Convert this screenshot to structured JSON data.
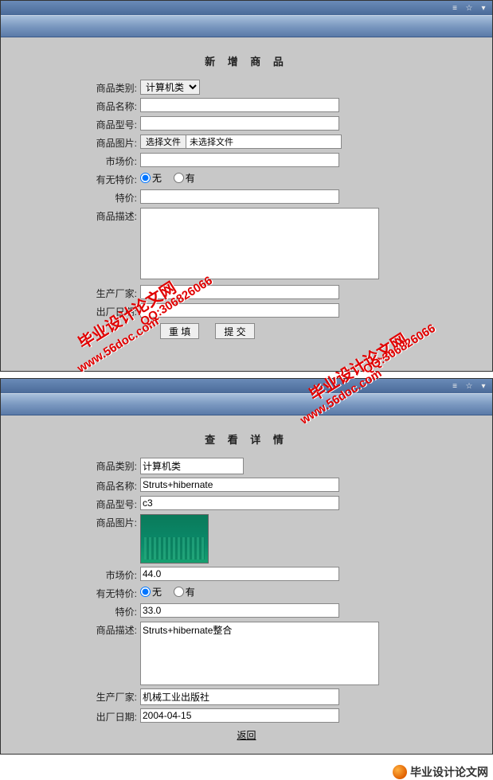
{
  "window1": {
    "title": "新 增 商 品",
    "labels": {
      "category": "商品类别:",
      "name": "商品名称:",
      "model": "商品型号:",
      "image": "商品图片:",
      "market_price": "市场价:",
      "has_special": "有无特价:",
      "special_price": "特价:",
      "description": "商品描述:",
      "manufacturer": "生产厂家:",
      "out_date": "出厂日期:"
    },
    "category_option": "计算机类",
    "file_button": "选择文件",
    "file_status": "未选择文件",
    "radio_no": "无",
    "radio_yes": "有",
    "buttons": {
      "reset": "重 填",
      "submit": "提 交"
    }
  },
  "window2": {
    "title": "查 看 详 情",
    "labels": {
      "category": "商品类别:",
      "name": "商品名称:",
      "model": "商品型号:",
      "image": "商品图片:",
      "market_price": "市场价:",
      "has_special": "有无特价:",
      "special_price": "特价:",
      "description": "商品描述:",
      "manufacturer": "生产厂家:",
      "out_date": "出厂日期:"
    },
    "values": {
      "category": "计算机类",
      "name": "Struts+hibernate",
      "model": "c3",
      "market_price": "44.0",
      "special_price": "33.0",
      "description": "Struts+hibernate整合",
      "manufacturer": "机械工业出版社",
      "out_date": "2004-04-15"
    },
    "radio_no": "无",
    "radio_yes": "有",
    "back": "返回"
  },
  "watermark": {
    "main": "毕业设计论文网",
    "url": "www.56doc.com",
    "qq": "QQ:306826066"
  },
  "footer": {
    "text": "毕业设计论文网"
  }
}
